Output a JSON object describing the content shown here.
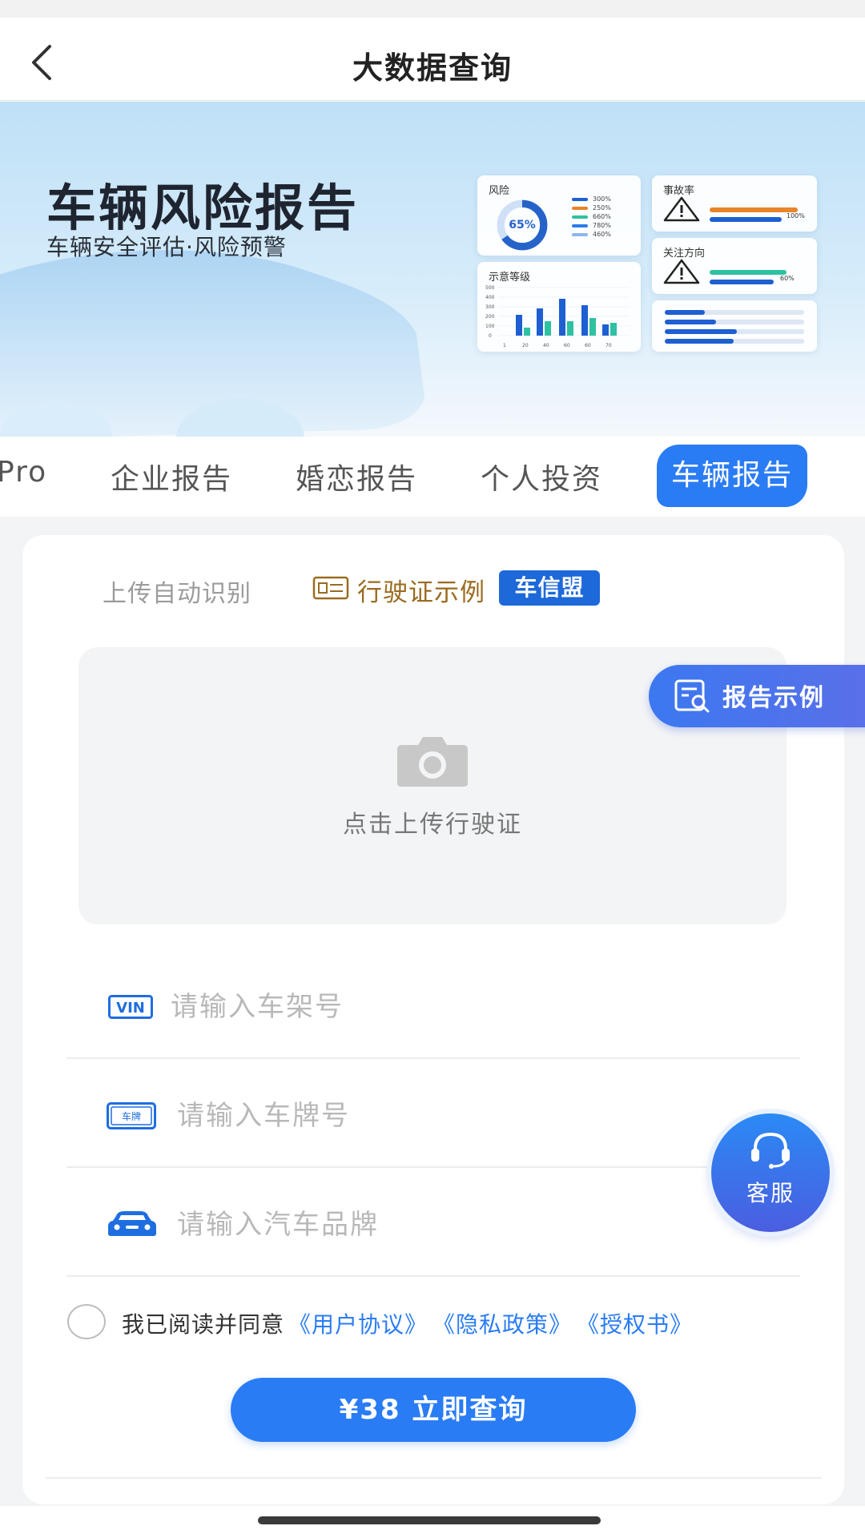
{
  "header": {
    "title": "大数据查询"
  },
  "banner": {
    "title": "车辆风险报告",
    "subtitle": "车辆安全评估·风险预警",
    "risk_card": {
      "label": "风险",
      "percent": "65%",
      "legend": [
        "300%",
        "250%",
        "660%",
        "780%",
        "460%"
      ]
    },
    "level_card": {
      "label": "示意等级",
      "y_ticks": [
        "500",
        "400",
        "300",
        "200",
        "100",
        "0"
      ],
      "x_ticks": [
        "1",
        "20",
        "40",
        "60",
        "60",
        "70"
      ]
    },
    "accident_card": {
      "label": "事故率",
      "value": "100%"
    },
    "focus_card": {
      "label": "关注方向",
      "value": "60%"
    }
  },
  "tabs": {
    "items": [
      {
        "label": "Pro"
      },
      {
        "label": "企业报告"
      },
      {
        "label": "婚恋报告"
      },
      {
        "label": "个人投资"
      },
      {
        "label": "车辆报告"
      }
    ],
    "active_index": 4
  },
  "form": {
    "upload_auto_label": "上传自动识别",
    "license_example_link": "行驶证示例",
    "brand_badge": "车信盟",
    "upload_text": "点击上传行驶证",
    "vin": {
      "icon_text": "VIN",
      "placeholder": "请输入车架号",
      "value": ""
    },
    "plate": {
      "icon_text": "车牌",
      "placeholder": "请输入车牌号",
      "value": ""
    },
    "brand": {
      "placeholder": "请输入汽车品牌",
      "value": ""
    },
    "agree_text": "我已阅读并同意",
    "links": [
      "《用户协议》",
      "《隐私政策》",
      "《授权书》"
    ],
    "query_button": "¥38 立即查询"
  },
  "floating": {
    "report_sample": "报告示例",
    "customer_service": "客服"
  },
  "colors": {
    "primary": "#2a7cf4",
    "brand_badge": "#1e69d9",
    "license_link": "#9a6b1f"
  }
}
